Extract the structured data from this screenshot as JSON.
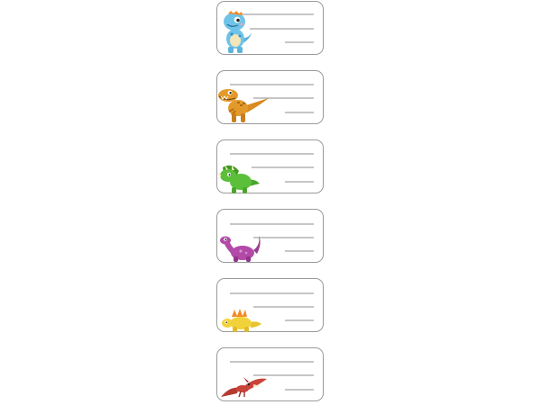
{
  "sheet": {
    "labels": [
      {
        "dinosaur": "blue-baby-dinosaur-icon",
        "color": "#6fc3e8"
      },
      {
        "dinosaur": "orange-t-rex-icon",
        "color": "#e39a2b"
      },
      {
        "dinosaur": "green-triceratops-icon",
        "color": "#5cbf3a"
      },
      {
        "dinosaur": "purple-long-neck-dinosaur-icon",
        "color": "#b24aa8"
      },
      {
        "dinosaur": "yellow-stegosaurus-icon",
        "color": "#f2d23a"
      },
      {
        "dinosaur": "red-pterodactyl-icon",
        "color": "#c8433a"
      }
    ],
    "line_color": "#8c8c8c",
    "border_color": "#9a9a9a"
  }
}
